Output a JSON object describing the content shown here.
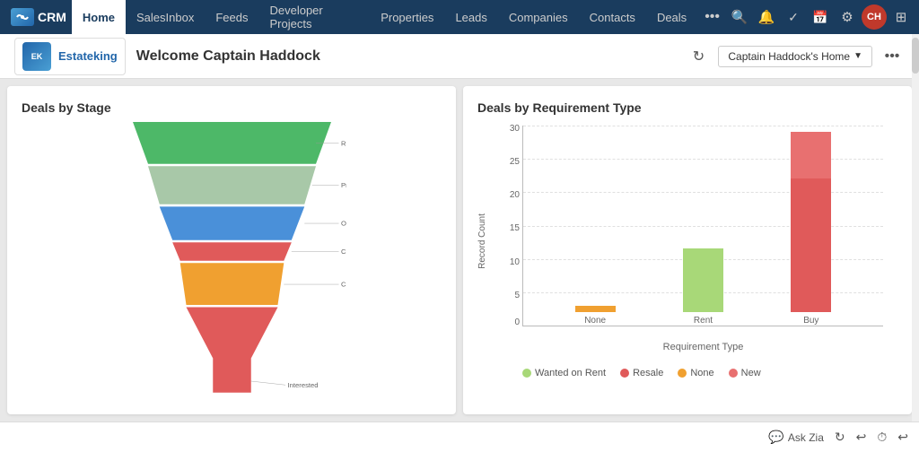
{
  "nav": {
    "logo_text": "CRM",
    "items": [
      {
        "label": "Home",
        "active": true
      },
      {
        "label": "SalesInbox",
        "active": false
      },
      {
        "label": "Feeds",
        "active": false
      },
      {
        "label": "Developer Projects",
        "active": false
      },
      {
        "label": "Properties",
        "active": false
      },
      {
        "label": "Leads",
        "active": false
      },
      {
        "label": "Companies",
        "active": false
      },
      {
        "label": "Contacts",
        "active": false
      },
      {
        "label": "Deals",
        "active": false
      }
    ],
    "more_label": "...",
    "icons": [
      "search",
      "bell",
      "calendar-check",
      "calendar",
      "gear",
      "avatar",
      "grid"
    ]
  },
  "header": {
    "company_name": "Estateking",
    "welcome_text": "Welcome Captain Haddock",
    "home_dropdown": "Captain Haddock's Home",
    "refresh_title": "Refresh",
    "more_title": "More"
  },
  "funnel_chart": {
    "title": "Deals by Stage",
    "stages": [
      {
        "label": "Recommendation",
        "color": "#4db868",
        "width_pct": 100
      },
      {
        "label": "Property Selected",
        "color": "#a8c8a8",
        "width_pct": 88
      },
      {
        "label": "Offer",
        "color": "#4a90d9",
        "width_pct": 72
      },
      {
        "label": "Contract Out",
        "color": "#e05a5a",
        "width_pct": 58
      },
      {
        "label": "Contract Signed",
        "color": "#f0a030",
        "width_pct": 72
      },
      {
        "label": "Interested",
        "color": "#e05a5a",
        "width_pct": 38
      }
    ]
  },
  "bar_chart": {
    "title": "Deals by Requirement Type",
    "y_axis_label": "Record Count",
    "x_axis_label": "Requirement Type",
    "y_max": 30,
    "y_ticks": [
      0,
      5,
      10,
      15,
      20,
      25,
      30
    ],
    "groups": [
      {
        "label": "None",
        "segments": [
          {
            "color": "#f0a030",
            "value": 1,
            "series": "None"
          },
          {
            "color": "#e05a5a",
            "value": 0,
            "series": "Resale"
          }
        ]
      },
      {
        "label": "Rent",
        "segments": [
          {
            "color": "#a8d878",
            "value": 9.5,
            "series": "Wanted on Rent"
          },
          {
            "color": "#e05a5a",
            "value": 0,
            "series": "Resale"
          }
        ]
      },
      {
        "label": "Buy",
        "segments": [
          {
            "color": "#e05a5a",
            "value": 20,
            "series": "Resale"
          },
          {
            "color": "#e87070",
            "value": 7,
            "series": "New"
          }
        ]
      }
    ],
    "legend": [
      {
        "label": "Wanted on Rent",
        "color": "#a8d878"
      },
      {
        "label": "Resale",
        "color": "#e05a5a"
      },
      {
        "label": "None",
        "color": "#f0a030"
      },
      {
        "label": "New",
        "color": "#e87070"
      }
    ]
  },
  "status_bar": {
    "ask_zia": "Ask Zia",
    "icons": [
      "chat",
      "refresh",
      "undo",
      "clock",
      "settings"
    ]
  }
}
